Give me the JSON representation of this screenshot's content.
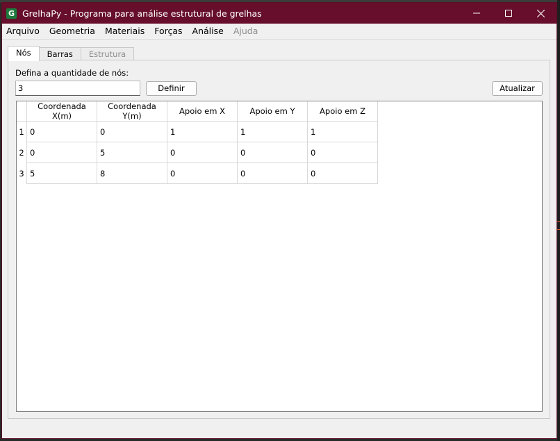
{
  "window": {
    "app_icon_letter": "G",
    "title": "GrelhaPy - Programa para análise estrutural de grelhas",
    "controls": [
      "minimize",
      "maximize",
      "close"
    ]
  },
  "menubar": {
    "items": [
      {
        "label": "Arquivo",
        "enabled": true
      },
      {
        "label": "Geometria",
        "enabled": true
      },
      {
        "label": "Materiais",
        "enabled": true
      },
      {
        "label": "Forças",
        "enabled": true
      },
      {
        "label": "Análise",
        "enabled": true
      },
      {
        "label": "Ajuda",
        "enabled": false
      }
    ]
  },
  "tabs": [
    {
      "label": "Nós",
      "active": true,
      "enabled": true
    },
    {
      "label": "Barras",
      "active": false,
      "enabled": true
    },
    {
      "label": "Estrutura",
      "active": false,
      "enabled": false
    }
  ],
  "nodes_panel": {
    "prompt_label": "Defina a quantidade de nós:",
    "quantity_value": "3",
    "define_button": "Definir",
    "update_button": "Atualizar",
    "table": {
      "columns": [
        "Coordenada X(m)",
        "Coordenada Y(m)",
        "Apoio em X",
        "Apoio em Y",
        "Apoio em Z"
      ],
      "rows": [
        {
          "index": "1",
          "cells": [
            "0",
            "0",
            "1",
            "1",
            "1"
          ]
        },
        {
          "index": "2",
          "cells": [
            "0",
            "5",
            "0",
            "0",
            "0"
          ]
        },
        {
          "index": "3",
          "cells": [
            "5",
            "8",
            "0",
            "0",
            "0"
          ]
        }
      ]
    }
  },
  "colors": {
    "titlebar": "#660e2b",
    "app_icon": "#1e7a3c"
  }
}
